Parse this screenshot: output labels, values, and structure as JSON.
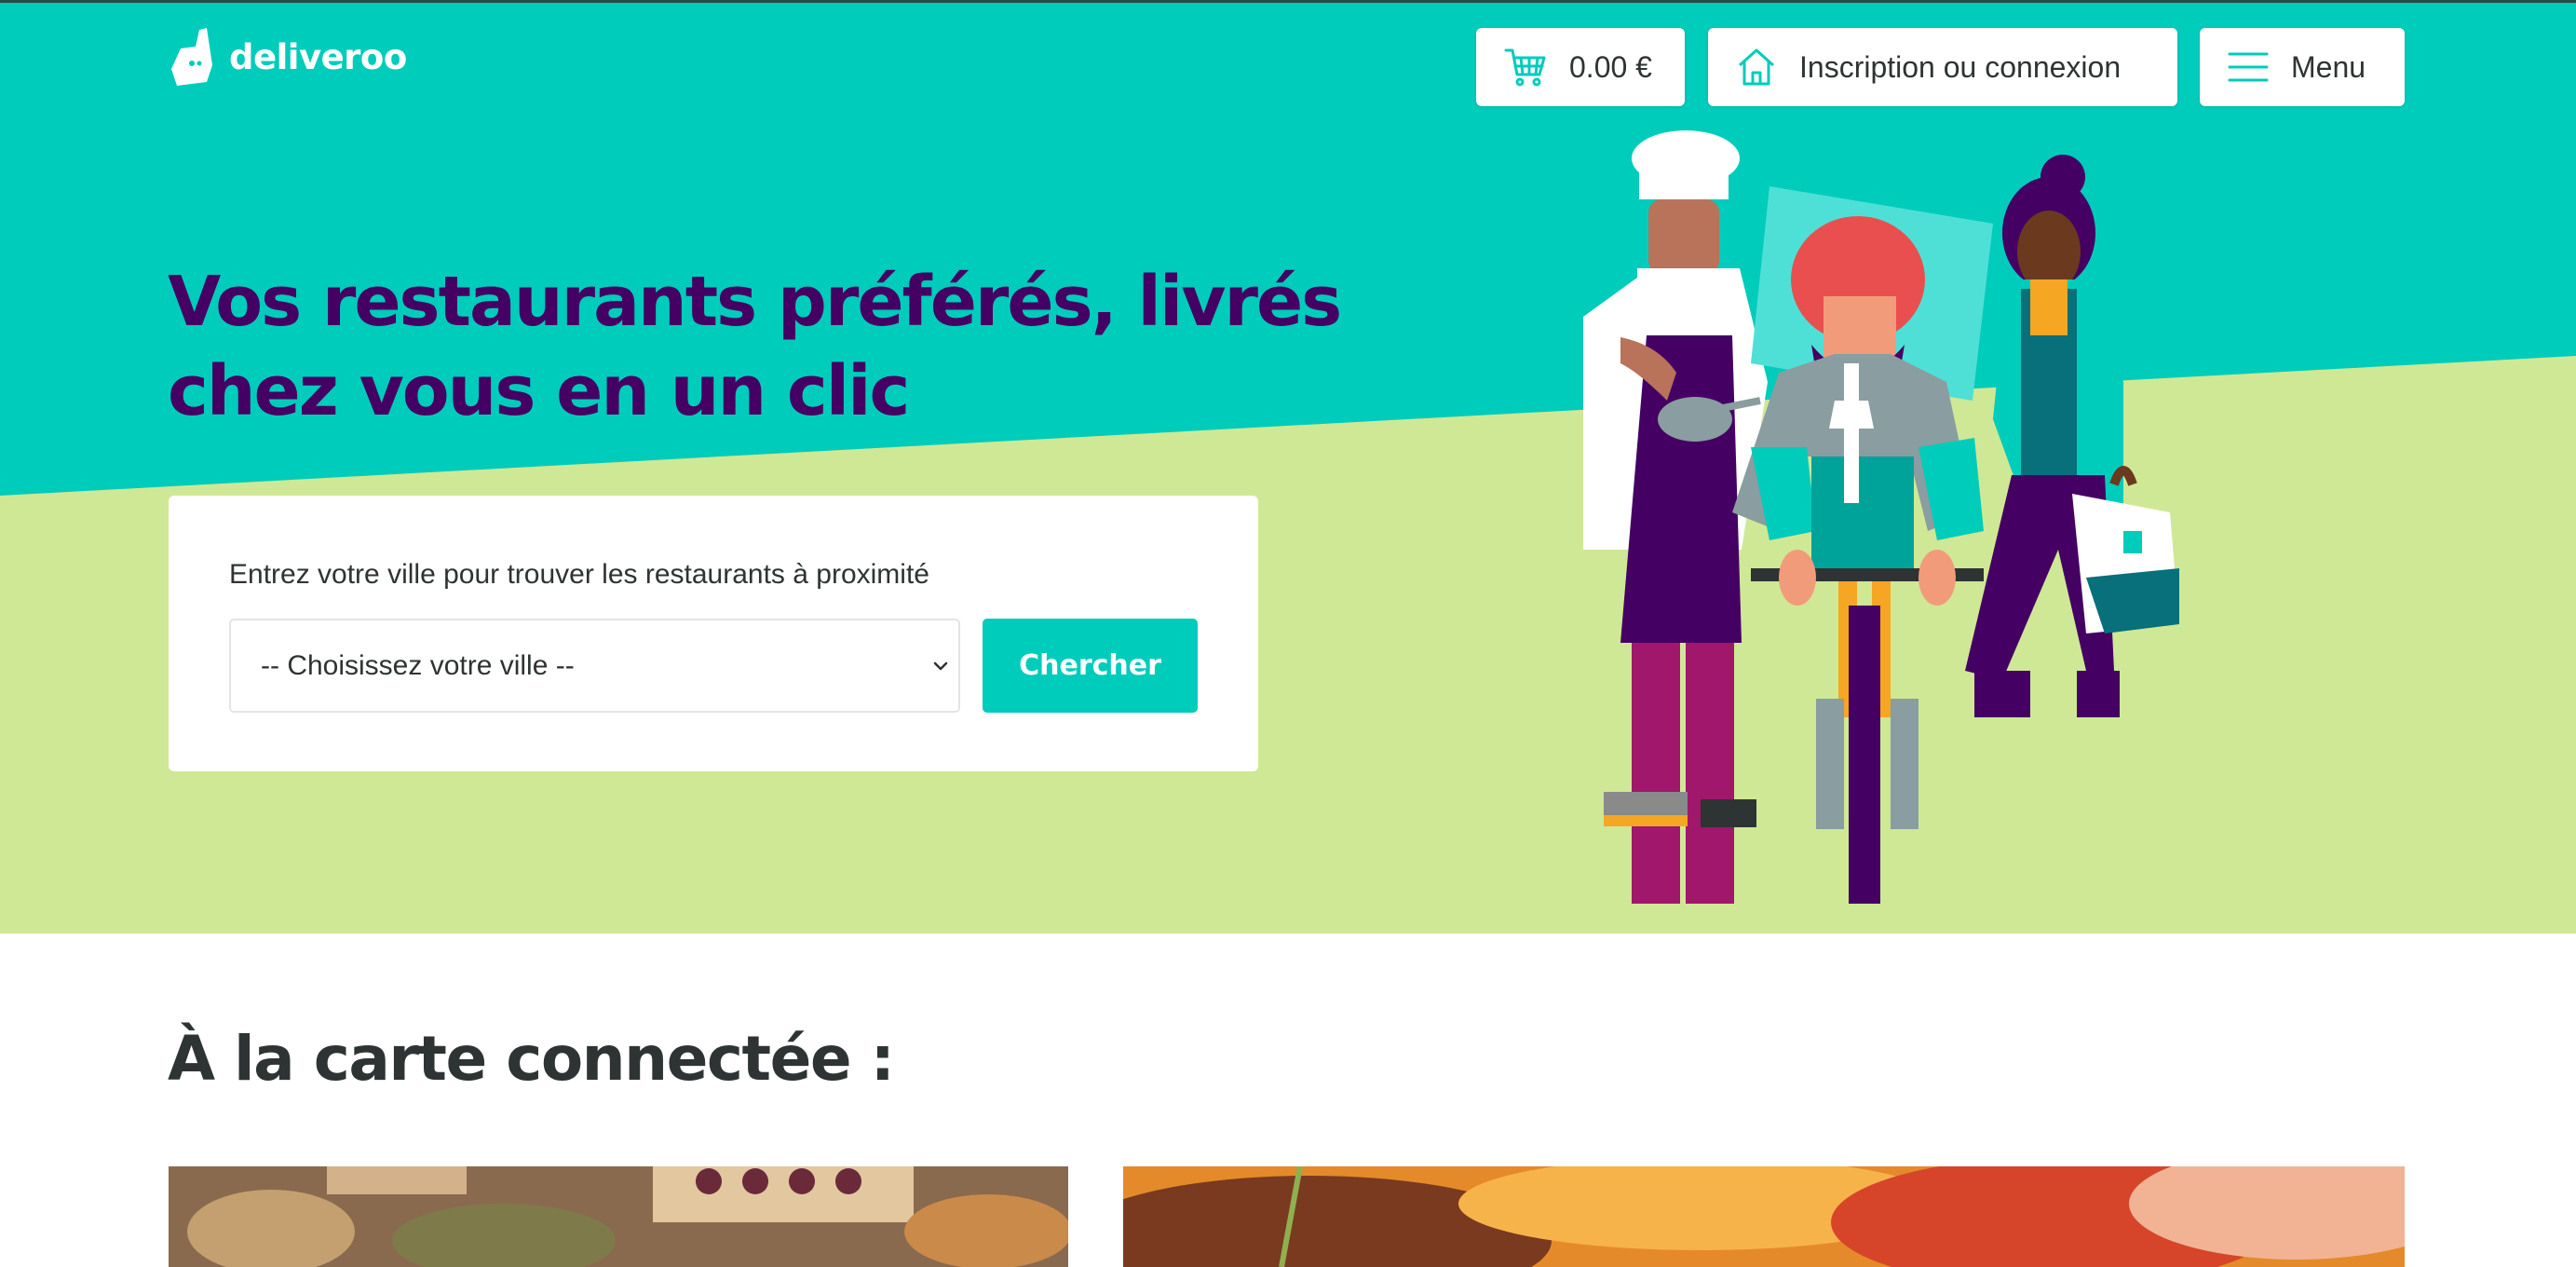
{
  "brand": {
    "name": "deliveroo",
    "logo_icon": "kangaroo-logo-icon"
  },
  "colors": {
    "teal": "#00ccbc",
    "lime": "#cfe895",
    "purple": "#440063",
    "text": "#2e3333",
    "white": "#ffffff"
  },
  "header": {
    "cart": {
      "icon": "cart-icon",
      "label": "0.00 €"
    },
    "login": {
      "icon": "home-icon",
      "label": "Inscription ou connexion"
    },
    "menu": {
      "icon": "hamburger-icon",
      "label": "Menu"
    }
  },
  "hero": {
    "headline_line1": "Vos restaurants préférés, livrés",
    "headline_line2": "chez vous en un clic",
    "search": {
      "label": "Entrez votre ville pour trouver les restaurants à proximité",
      "select_value": "-- Choisissez votre ville --",
      "button_label": "Chercher"
    }
  },
  "section": {
    "title": "À la carte connectée :"
  }
}
